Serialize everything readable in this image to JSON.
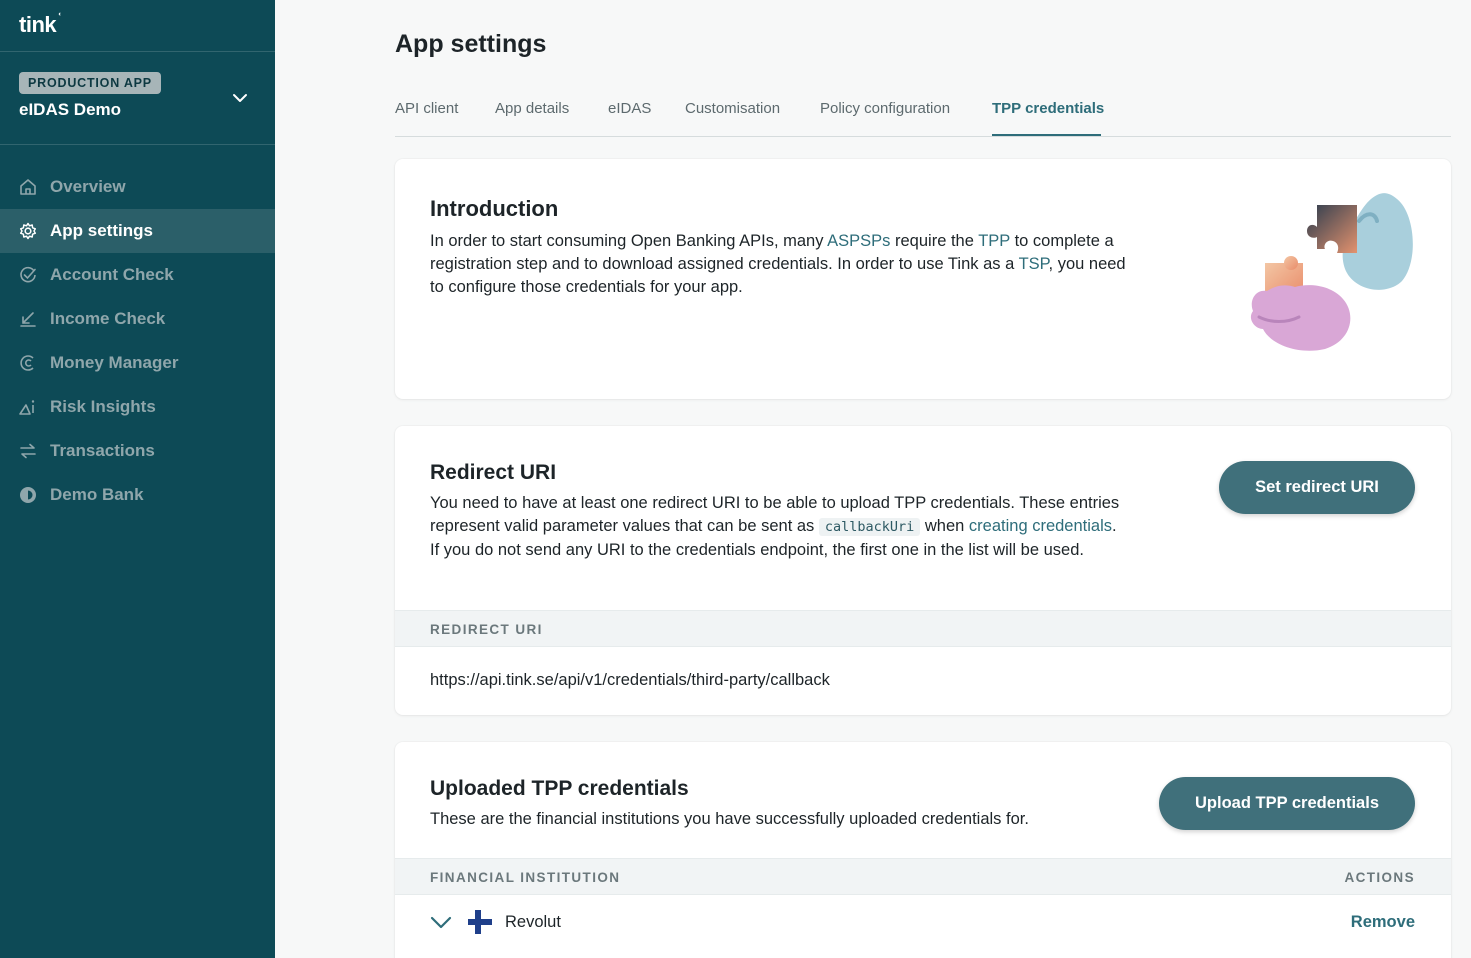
{
  "brand": {
    "logo_text": "tink",
    "logo_mark": "ʿ"
  },
  "app_switcher": {
    "badge": "PRODUCTION APP",
    "app_name": "eIDAS Demo",
    "icon": "chevron-down-icon"
  },
  "nav": {
    "items": [
      {
        "label": "Overview",
        "icon": "home-icon",
        "active": false
      },
      {
        "label": "App settings",
        "icon": "gear-icon",
        "active": true
      },
      {
        "label": "Account Check",
        "icon": "check-circle-icon",
        "active": false
      },
      {
        "label": "Income Check",
        "icon": "income-arrow-icon",
        "active": false
      },
      {
        "label": "Money Manager",
        "icon": "money-manager-icon",
        "active": false
      },
      {
        "label": "Risk Insights",
        "icon": "risk-insights-icon",
        "active": false
      },
      {
        "label": "Transactions",
        "icon": "transfer-arrows-icon",
        "active": false
      },
      {
        "label": "Demo Bank",
        "icon": "demo-bank-icon",
        "active": false
      }
    ]
  },
  "page": {
    "title": "App settings"
  },
  "tabs": [
    {
      "label": "API client",
      "active": false
    },
    {
      "label": "App details",
      "active": false
    },
    {
      "label": "eIDAS",
      "active": false
    },
    {
      "label": "Customisation",
      "active": false
    },
    {
      "label": "Policy configuration",
      "active": false
    },
    {
      "label": "TPP credentials",
      "active": true
    }
  ],
  "intro": {
    "title": "Introduction",
    "t1": "In order to start consuming Open Banking APIs, many ",
    "link_aspsps": "ASPSPs",
    "t2": " require the ",
    "link_tpp": "TPP",
    "t3": " to complete a registration step and to download assigned credentials. In order to use Tink as a ",
    "link_tsp": "TSP",
    "t4": ", you need to configure those credentials for your app.",
    "illustration": "puzzle-hands-illustration"
  },
  "redirect": {
    "title": "Redirect URI",
    "t1": "You need to have at least one redirect URI to be able to upload TPP credentials. These entries represent valid parameter values that can be sent as ",
    "code": "callbackUri",
    "t2": " when ",
    "link": "creating credentials",
    "t3": ". If you do not send any URI to the credentials endpoint, the first one in the list will be used.",
    "button": "Set redirect URI",
    "column_header": "REDIRECT URI",
    "uris": [
      "https://api.tink.se/api/v1/credentials/third-party/callback"
    ]
  },
  "uploaded": {
    "title": "Uploaded TPP credentials",
    "description": "These are the financial institutions you have successfully uploaded credentials for.",
    "button": "Upload TPP credentials",
    "col_institution": "FINANCIAL INSTITUTION",
    "col_actions": "ACTIONS",
    "rows": [
      {
        "name": "Revolut",
        "flag_icon": "finland-flag-icon",
        "action": "Remove"
      }
    ]
  },
  "colors": {
    "sidebar": "#0d4a56",
    "accent": "#2e6d7a",
    "button": "#40707b"
  }
}
